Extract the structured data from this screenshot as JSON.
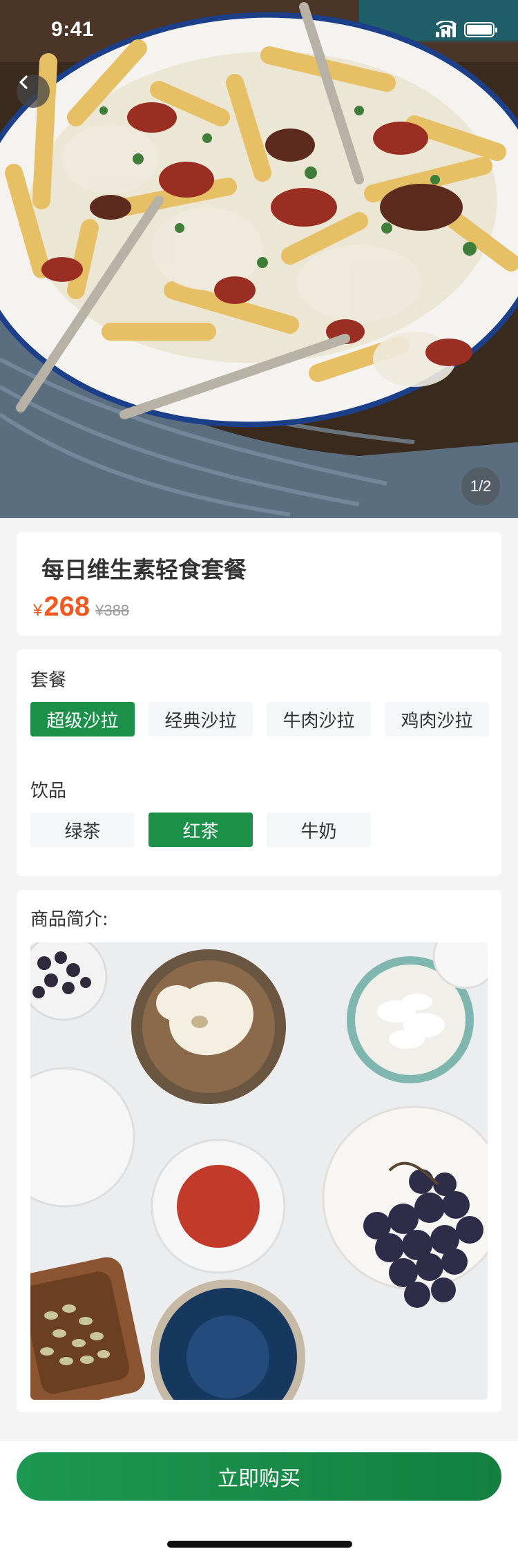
{
  "status_bar": {
    "time": "9:41"
  },
  "gallery": {
    "indicator": "1/2"
  },
  "product": {
    "title": "每日维生素轻食套餐",
    "currency": "¥",
    "price": "268",
    "original_price": "¥388"
  },
  "options": {
    "groups": [
      {
        "label": "套餐",
        "choices": [
          "超级沙拉",
          "经典沙拉",
          "牛肉沙拉",
          "鸡肉沙拉"
        ],
        "selected": "超级沙拉"
      },
      {
        "label": "饮品",
        "choices": [
          "绿茶",
          "红茶",
          "牛奶"
        ],
        "selected": "红茶"
      }
    ]
  },
  "description": {
    "title": "商品简介:"
  },
  "actions": {
    "buy_label": "立即购买"
  },
  "colors": {
    "accent": "#1a9048",
    "price": "#f05a1e"
  },
  "icons": {
    "back": "chevron-left-icon",
    "signal": "signal-icon",
    "wifi": "wifi-icon",
    "battery": "battery-icon"
  }
}
